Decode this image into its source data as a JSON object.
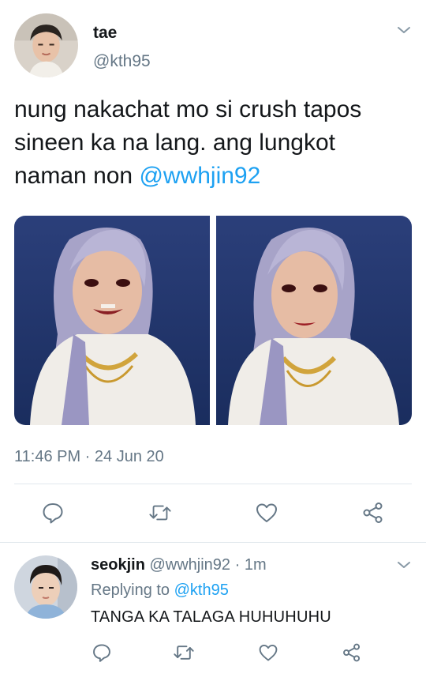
{
  "tweet": {
    "display_name": "tae",
    "handle": "@kth95",
    "text_before_mention": "nung nakachat mo si crush tapos sineen ka na lang. ang lungkot naman non ",
    "mention": "@wwhjin92",
    "timestamp": "11:46 PM · 24 Jun 20",
    "avatar_icon": "avatar-photo",
    "media": [
      {
        "description_icon": "photo-1"
      },
      {
        "description_icon": "photo-2"
      }
    ],
    "actions": {
      "reply_icon": "reply-icon",
      "retweet_icon": "retweet-icon",
      "like_icon": "heart-icon",
      "share_icon": "share-icon"
    }
  },
  "reply": {
    "display_name": "seokjin",
    "handle": "@wwhjin92",
    "dot": "·",
    "time": "1m",
    "replying_prefix": "Replying to ",
    "replying_to": "@kth95",
    "text": "TANGA KA TALAGA HUHUHUHU"
  },
  "colors": {
    "accent": "#1da1f2",
    "muted": "#657786",
    "text": "#14171a",
    "divider": "#e1e8ed"
  }
}
